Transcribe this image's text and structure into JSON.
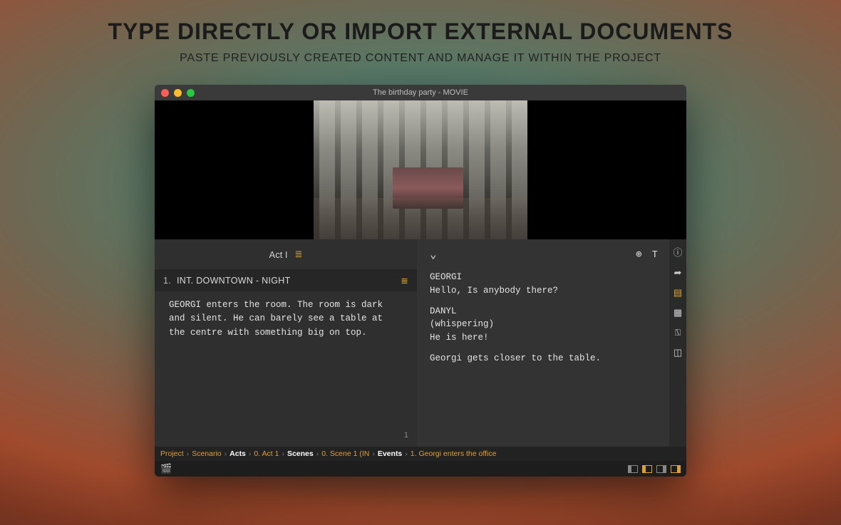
{
  "promo": {
    "title": "TYPE DIRECTLY OR IMPORT EXTERNAL DOCUMENTS",
    "subtitle": "PASTE PREVIOUSLY CREATED CONTENT AND MANAGE IT WITHIN THE PROJECT"
  },
  "window": {
    "title": "The birthday party - MOVIE"
  },
  "outline": {
    "act_label": "Act I",
    "scene_number": "1.",
    "scene_heading": "INT. DOWNTOWN - NIGHT",
    "scene_body": "GEORGI enters the room. The room is dark and silent. He can barely see a table at the centre with something big on top.",
    "page_number": "1"
  },
  "script": {
    "blocks": [
      {
        "type": "char",
        "text": "GEORGI"
      },
      {
        "type": "dial",
        "text": "Hello, Is anybody there?"
      },
      {
        "type": "char",
        "text": "DANYL"
      },
      {
        "type": "paren",
        "text": "(whispering)"
      },
      {
        "type": "dial",
        "text": "He is here!"
      },
      {
        "type": "action",
        "text": "Georgi gets closer to the table."
      }
    ]
  },
  "breadcrumbs": [
    {
      "label": "Project",
      "bold": false
    },
    {
      "label": "Scenario",
      "bold": false
    },
    {
      "label": "Acts",
      "bold": true
    },
    {
      "label": "0. Act 1",
      "bold": false
    },
    {
      "label": "Scenes",
      "bold": true
    },
    {
      "label": "0. Scene 1 (IN",
      "bold": false
    },
    {
      "label": "Events",
      "bold": true
    },
    {
      "label": "1. Georgi enters the office",
      "bold": false
    }
  ],
  "icons": {
    "list": "≣",
    "globe": "⊕",
    "text": "T",
    "chevron": "⌄",
    "info": "ⓘ",
    "share": "➦",
    "box": "▤",
    "doc": "▦",
    "img": "⍂",
    "split": "◫",
    "clap": "🎬"
  }
}
